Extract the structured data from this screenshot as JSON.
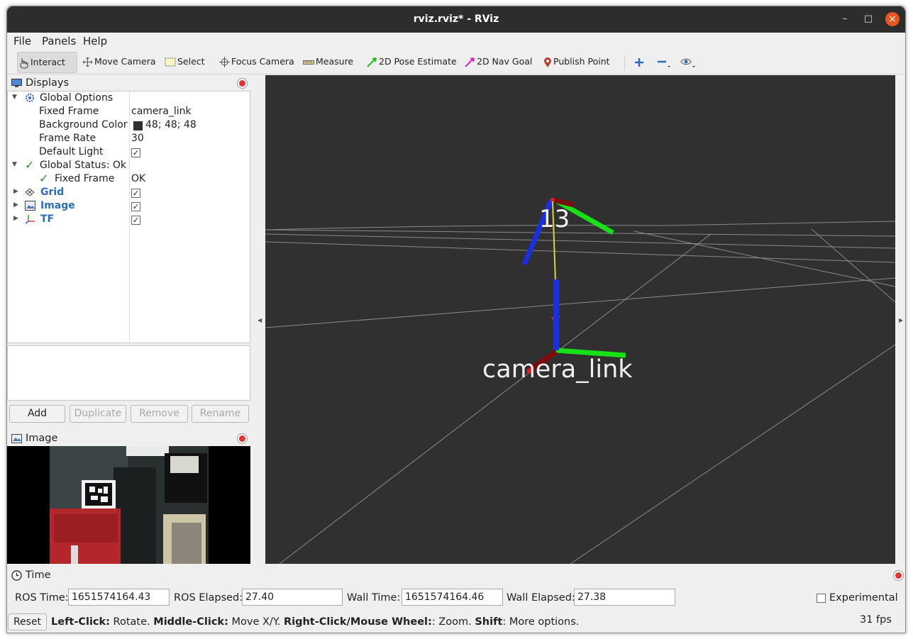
{
  "window": {
    "title": "rviz.rviz* - RViz"
  },
  "menu": {
    "file": "File",
    "panels": "Panels",
    "help": "Help"
  },
  "toolbar": {
    "interact": "Interact",
    "move_camera": "Move Camera",
    "select": "Select",
    "focus_camera": "Focus Camera",
    "measure": "Measure",
    "pose_estimate": "2D Pose Estimate",
    "nav_goal": "2D Nav Goal",
    "publish_point": "Publish Point"
  },
  "displays": {
    "title": "Displays",
    "global_options": "Global Options",
    "fixed_frame_label": "Fixed Frame",
    "fixed_frame_value": "camera_link",
    "bg_color_label": "Background Color",
    "bg_color_value": "48; 48; 48",
    "bg_color_hex": "#303030",
    "frame_rate_label": "Frame Rate",
    "frame_rate_value": "30",
    "default_light_label": "Default Light",
    "global_status": "Global Status: Ok",
    "status_fixed_frame": "Fixed Frame",
    "status_fixed_frame_value": "OK",
    "grid": "Grid",
    "image": "Image",
    "tf": "TF",
    "buttons": {
      "add": "Add",
      "duplicate": "Duplicate",
      "remove": "Remove",
      "rename": "Rename"
    }
  },
  "image_panel": {
    "title": "Image"
  },
  "viewport": {
    "marker_id": "13",
    "frame_label": "camera_link"
  },
  "time_panel": {
    "title": "Time",
    "ros_time_label": "ROS Time:",
    "ros_time": "1651574164.43",
    "ros_elapsed_label": "ROS Elapsed:",
    "ros_elapsed": "27.40",
    "wall_time_label": "Wall Time:",
    "wall_time": "1651574164.46",
    "wall_elapsed_label": "Wall Elapsed:",
    "wall_elapsed": "27.38",
    "experimental": "Experimental"
  },
  "status_bar": {
    "reset": "Reset",
    "k1": "Left-Click:",
    "t1": " Rotate. ",
    "k2": "Middle-Click:",
    "t2": " Move X/Y. ",
    "k3": "Right-Click/Mouse Wheel:",
    "t3": ": Zoom. ",
    "k4": "Shift",
    "t4": ": More options.",
    "fps": "31 fps"
  },
  "colors": {
    "accent": "#e95420",
    "link_blue": "#2a6ebb",
    "check_green": "#2a8a2a"
  }
}
